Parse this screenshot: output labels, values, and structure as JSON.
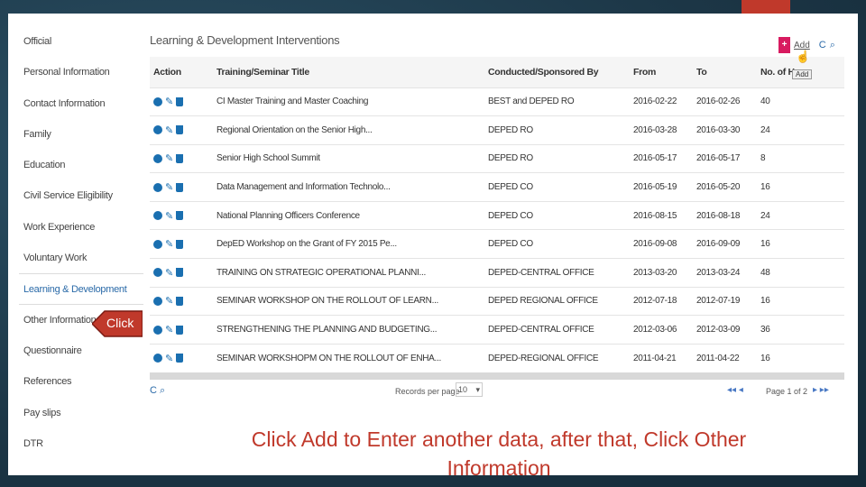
{
  "sidebar": {
    "items": [
      {
        "label": "Official"
      },
      {
        "label": "Personal Information"
      },
      {
        "label": "Contact Information"
      },
      {
        "label": "Family"
      },
      {
        "label": "Education"
      },
      {
        "label": "Civil Service Eligibility"
      },
      {
        "label": "Work Experience"
      },
      {
        "label": "Voluntary Work"
      },
      {
        "label": "Learning & Development",
        "active": true
      },
      {
        "label": "Other Information"
      },
      {
        "label": "Questionnaire"
      },
      {
        "label": "References"
      },
      {
        "label": "Pay slips"
      },
      {
        "label": "DTR"
      }
    ]
  },
  "panel": {
    "title": "Learning & Development Interventions",
    "add_icon": "+",
    "add_label": "Add",
    "tooltip": "Add",
    "refresh_icon": "C",
    "search_icon": "⌕"
  },
  "table": {
    "headers": [
      "Action",
      "Training/Seminar Title",
      "Conducted/Sponsored By",
      "From",
      "To",
      "No. of Ho"
    ],
    "rows": [
      {
        "title": "CI Master Training and Master Coaching",
        "by": "BEST and DEPED RO",
        "from": "2016-02-22",
        "to": "2016-02-26",
        "hours": "40"
      },
      {
        "title": "Regional Orientation on the Senior High...",
        "by": "DEPED RO",
        "from": "2016-03-28",
        "to": "2016-03-30",
        "hours": "24"
      },
      {
        "title": "Senior High School Summit",
        "by": "DEPED RO",
        "from": "2016-05-17",
        "to": "2016-05-17",
        "hours": "8"
      },
      {
        "title": "Data Management and Information Technolo...",
        "by": "DEPED CO",
        "from": "2016-05-19",
        "to": "2016-05-20",
        "hours": "16"
      },
      {
        "title": "National Planning Officers Conference",
        "by": "DEPED CO",
        "from": "2016-08-15",
        "to": "2016-08-18",
        "hours": "24"
      },
      {
        "title": "DepED Workshop on the Grant of FY 2015 Pe...",
        "by": "DEPED CO",
        "from": "2016-09-08",
        "to": "2016-09-09",
        "hours": "16"
      },
      {
        "title": "TRAINING ON STRATEGIC OPERATIONAL PLANNI...",
        "by": "DEPED-CENTRAL OFFICE",
        "from": "2013-03-20",
        "to": "2013-03-24",
        "hours": "48"
      },
      {
        "title": "SEMINAR WORKSHOP ON THE ROLLOUT OF LEARN...",
        "by": "DEPED REGIONAL OFFICE",
        "from": "2012-07-18",
        "to": "2012-07-19",
        "hours": "16"
      },
      {
        "title": "STRENGTHENING THE PLANNING AND BUDGETING...",
        "by": "DEPED-CENTRAL OFFICE",
        "from": "2012-03-06",
        "to": "2012-03-09",
        "hours": "36"
      },
      {
        "title": "SEMINAR WORKSHOPM ON THE ROLLOUT OF ENHA...",
        "by": "DEPED-REGIONAL OFFICE",
        "from": "2011-04-21",
        "to": "2011-04-22",
        "hours": "16"
      }
    ]
  },
  "pager": {
    "records_label": "Records per page",
    "records_value": "10",
    "first_prev": "◂◂ ◂",
    "page_label": "Page 1 of 2",
    "next_last": "▸ ▸▸"
  },
  "annotation": {
    "click_label": "Click",
    "caption": "Click Add to Enter another data, after that, Click Other Information"
  },
  "colors": {
    "accent": "#c0392b",
    "link": "#2a6aa8",
    "add_button": "#d81b60"
  }
}
